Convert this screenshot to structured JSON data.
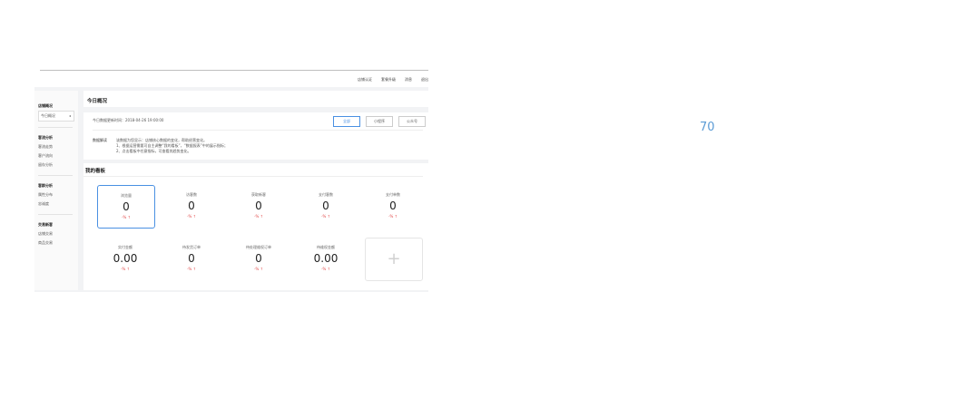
{
  "topnav": {
    "items": [
      "店铺认证",
      "套餐升级",
      "消息",
      "退出"
    ]
  },
  "sidebar": {
    "groups": [
      {
        "head": "店铺概况",
        "items": [
          "今日概况"
        ]
      },
      {
        "head": "客流分析",
        "items": [
          "客流走势",
          "客户流向",
          "留存分析"
        ]
      },
      {
        "head": "客群分析",
        "items": [
          "属性分布",
          "忠诚度"
        ]
      },
      {
        "head": "交易新客",
        "items": [
          "店铺交易",
          "商品交易"
        ]
      }
    ]
  },
  "main": {
    "page_title": "今日概况",
    "update_time": "今日数据更新时间：2018-04-26 19:00:00",
    "segments": [
      "全部",
      "小程序",
      "公众号"
    ],
    "explain_label": "数据解读",
    "explain_lines": [
      "该数据为您显示：店铺核心数据的变化，帮助经营变化。",
      "1、根据运营需要可自主调整“我的看板”，“数据报表”中的展示指标；",
      "2、点击看板中任意指标，可查看其趋势变化。"
    ],
    "board_title": "我的看板",
    "stats": [
      {
        "label": "浏览量",
        "value": "0",
        "change": "-% ↑"
      },
      {
        "label": "访客数",
        "value": "0",
        "change": "-% ↑"
      },
      {
        "label": "获取新客",
        "value": "0",
        "change": "-% ↑"
      },
      {
        "label": "支付客数",
        "value": "0",
        "change": "-% ↑"
      },
      {
        "label": "支付单数",
        "value": "0",
        "change": "-% ↑"
      },
      {
        "label": "实付金额",
        "value": "0.00",
        "change": "-% ↑"
      },
      {
        "label": "待发货订单",
        "value": "0",
        "change": "-% ↑"
      },
      {
        "label": "待处理维权订单",
        "value": "0",
        "change": "-% ↑"
      },
      {
        "label": "待维权金额",
        "value": "0.00",
        "change": "-% ↑"
      }
    ],
    "add_symbol": "+"
  },
  "side_number": "70",
  "colors": {
    "accent": "#4a90e2",
    "up": "#e24a4a"
  }
}
